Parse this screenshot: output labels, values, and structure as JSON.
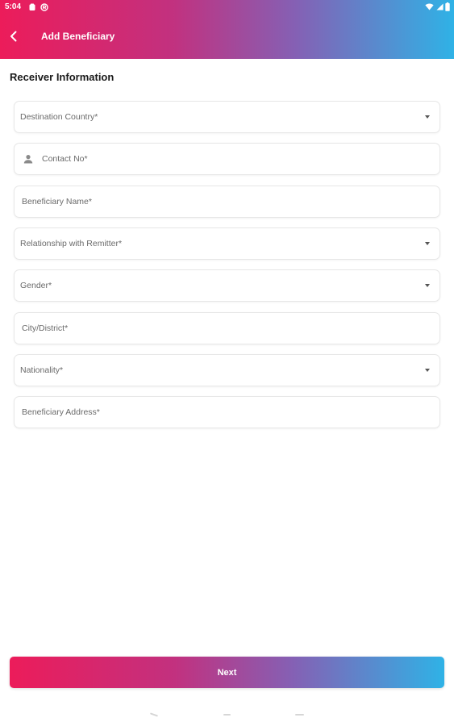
{
  "status_bar": {
    "time": "5:04"
  },
  "header": {
    "title": "Add Beneficiary",
    "back_icon": "chevron-left-icon"
  },
  "section": {
    "title": "Receiver Information"
  },
  "form": {
    "destination_country": "Destination Country*",
    "contact_no": "Contact No*",
    "beneficiary_name": "Beneficiary Name*",
    "relationship": "Relationship with Remitter*",
    "gender": "Gender*",
    "city_district": "City/District*",
    "nationality": "Nationality*",
    "beneficiary_address": "Beneficiary Address*"
  },
  "actions": {
    "next_label": "Next"
  },
  "colors": {
    "gradient_start": "#ec1c5a",
    "gradient_mid": "#8560b4",
    "gradient_end": "#2fb2e6"
  }
}
